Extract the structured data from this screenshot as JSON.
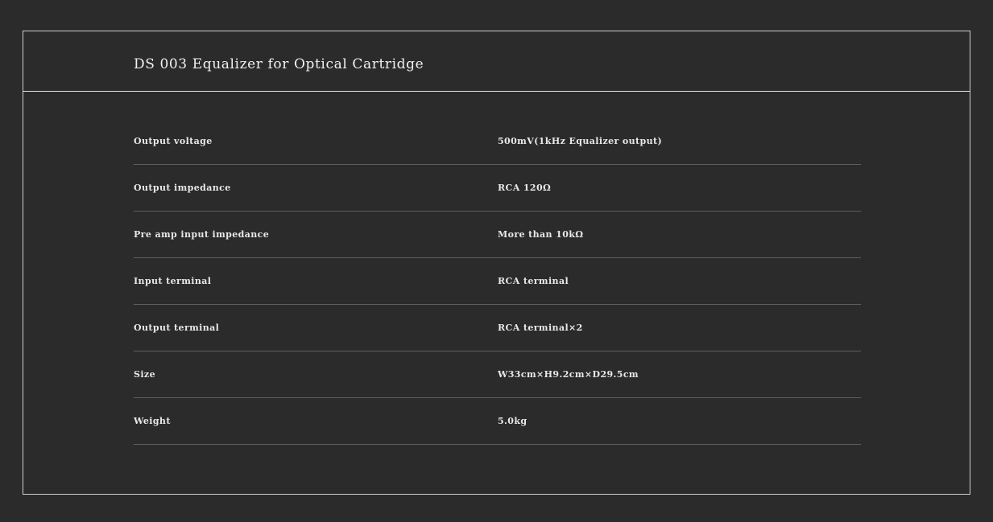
{
  "header": {
    "title": "DS 003 Equalizer for Optical Cartridge"
  },
  "specs": [
    {
      "label": "Output voltage",
      "value": "500mV(1kHz Equalizer output)"
    },
    {
      "label": "Output impedance",
      "value": "RCA 120Ω"
    },
    {
      "label": "Pre amp input impedance",
      "value": "More than 10kΩ"
    },
    {
      "label": "Input terminal",
      "value": "RCA terminal"
    },
    {
      "label": "Output terminal",
      "value": "RCA terminal×2"
    },
    {
      "label": "Size",
      "value": "W33cm×H9.2cm×D29.5cm"
    },
    {
      "label": "Weight",
      "value": "5.0kg"
    }
  ]
}
